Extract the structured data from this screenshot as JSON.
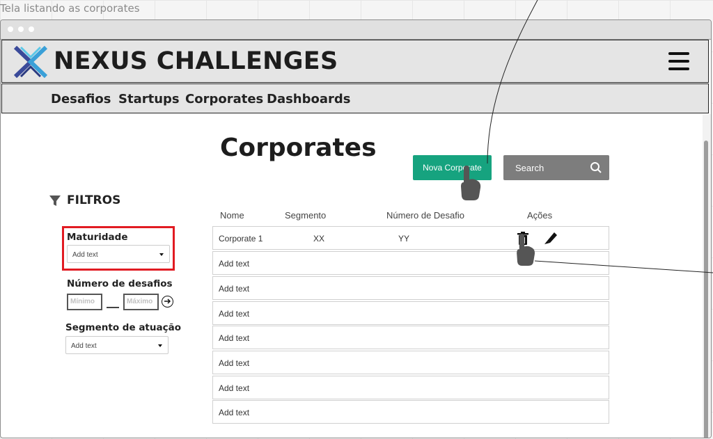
{
  "caption": "Tela listando as corporates",
  "app": {
    "brand": "NEXUS CHALLENGES",
    "icons": {
      "logo": "x-logo-icon",
      "menu": "hamburger-icon"
    }
  },
  "nav": {
    "items": [
      {
        "label": "Desafios"
      },
      {
        "label": "Startups"
      },
      {
        "label": "Corporates"
      },
      {
        "label": "Dashboards"
      }
    ]
  },
  "main": {
    "title": "Corporates",
    "new_button": "Nova Corporate",
    "search_label": "Search"
  },
  "filters": {
    "title": "FILTROS",
    "maturidade": {
      "label": "Maturidade",
      "placeholder": "Add text"
    },
    "num_desafios": {
      "label": "Número de desafios",
      "min": "Mínimo",
      "max": "Máximo"
    },
    "segmento": {
      "label": "Segmento de atuação",
      "placeholder": "Add text"
    }
  },
  "table": {
    "headers": [
      "Nome",
      "Segmento",
      "Número de Desafio",
      "Ações"
    ],
    "rows": [
      {
        "nome": "Corporate 1",
        "segmento": "XX",
        "desafios": "YY",
        "actions": [
          "trash-icon",
          "edit-icon"
        ]
      },
      {
        "nome": "Add text"
      },
      {
        "nome": "Add text"
      },
      {
        "nome": "Add text"
      },
      {
        "nome": "Add text"
      },
      {
        "nome": "Add text"
      },
      {
        "nome": "Add text"
      },
      {
        "nome": "Add text"
      }
    ]
  },
  "colors": {
    "accent": "#16a37f",
    "search_bg": "#7d7d7d",
    "highlight": "#e11b22"
  }
}
